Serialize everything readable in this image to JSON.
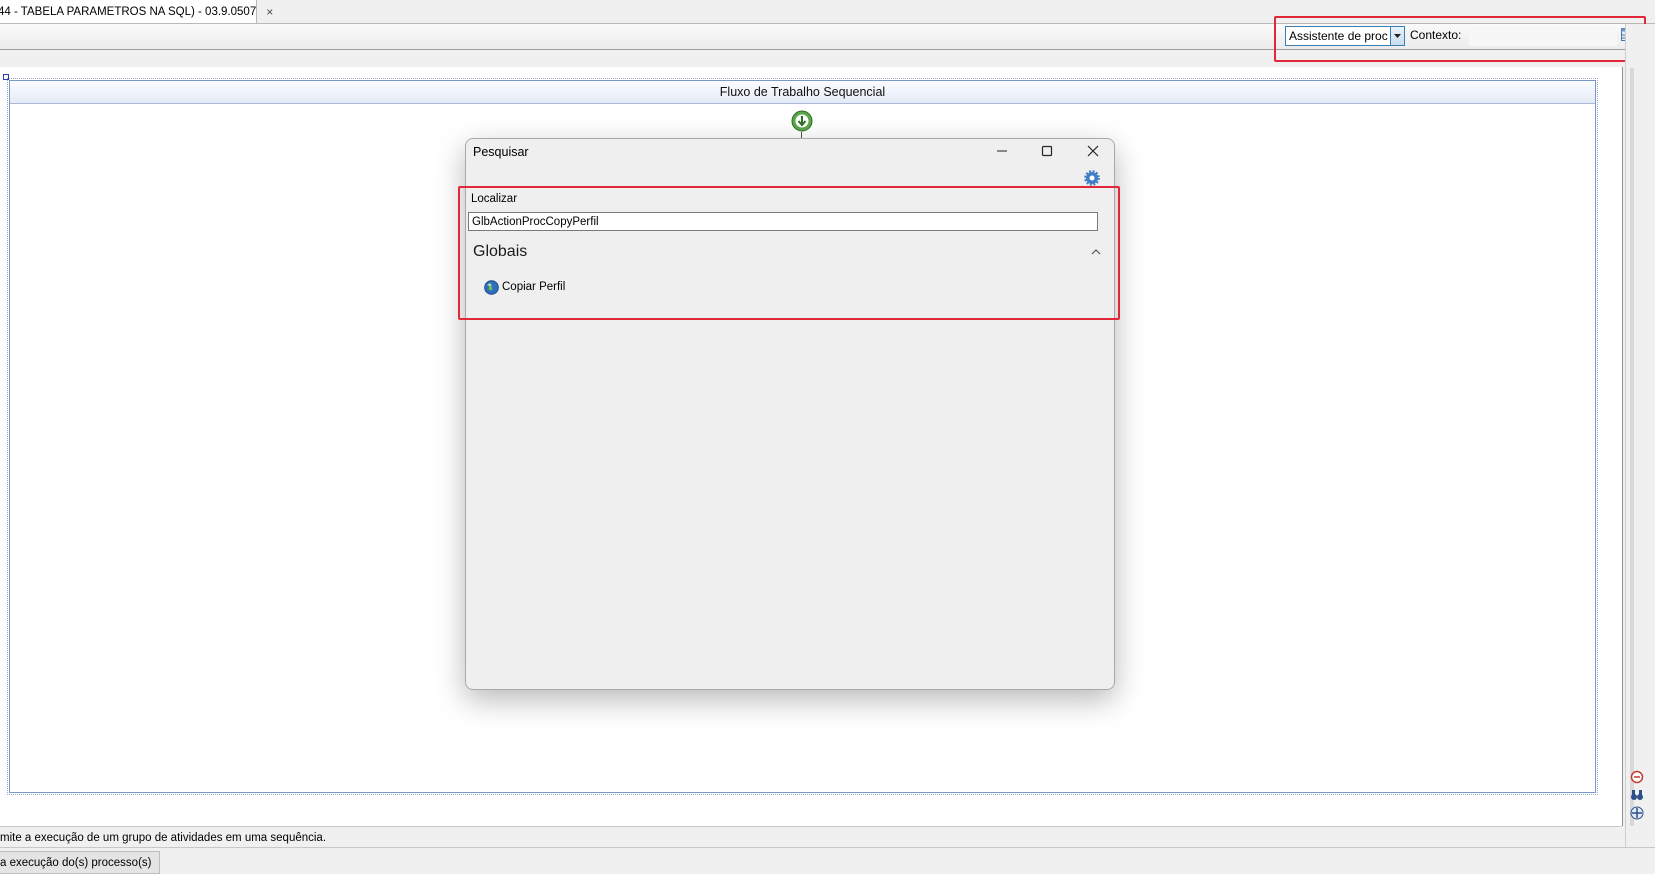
{
  "tab": {
    "title": "44 - TABELA PARAMETROS NA SQL) - 03.9.0507",
    "close": "×"
  },
  "toolbar": {
    "combo_value": "Assistente de proc",
    "context_label": "Contexto:"
  },
  "canvas": {
    "sequence_title": "Fluxo de Trabalho Sequencial"
  },
  "dialog": {
    "title": "Pesquisar",
    "find_label": "Localizar",
    "find_value": "GlbActionProcCopyPerfil",
    "group_title": "Globais",
    "items": [
      {
        "label": "Copiar Perfil",
        "icon": "globe-icon"
      }
    ]
  },
  "status": {
    "description": "mite a execução de um grupo de atividades em uma sequência.",
    "tab_label": "a execução do(s) processo(s)"
  },
  "colors": {
    "highlight": "#e0283a",
    "accent": "#3c7fb1"
  }
}
